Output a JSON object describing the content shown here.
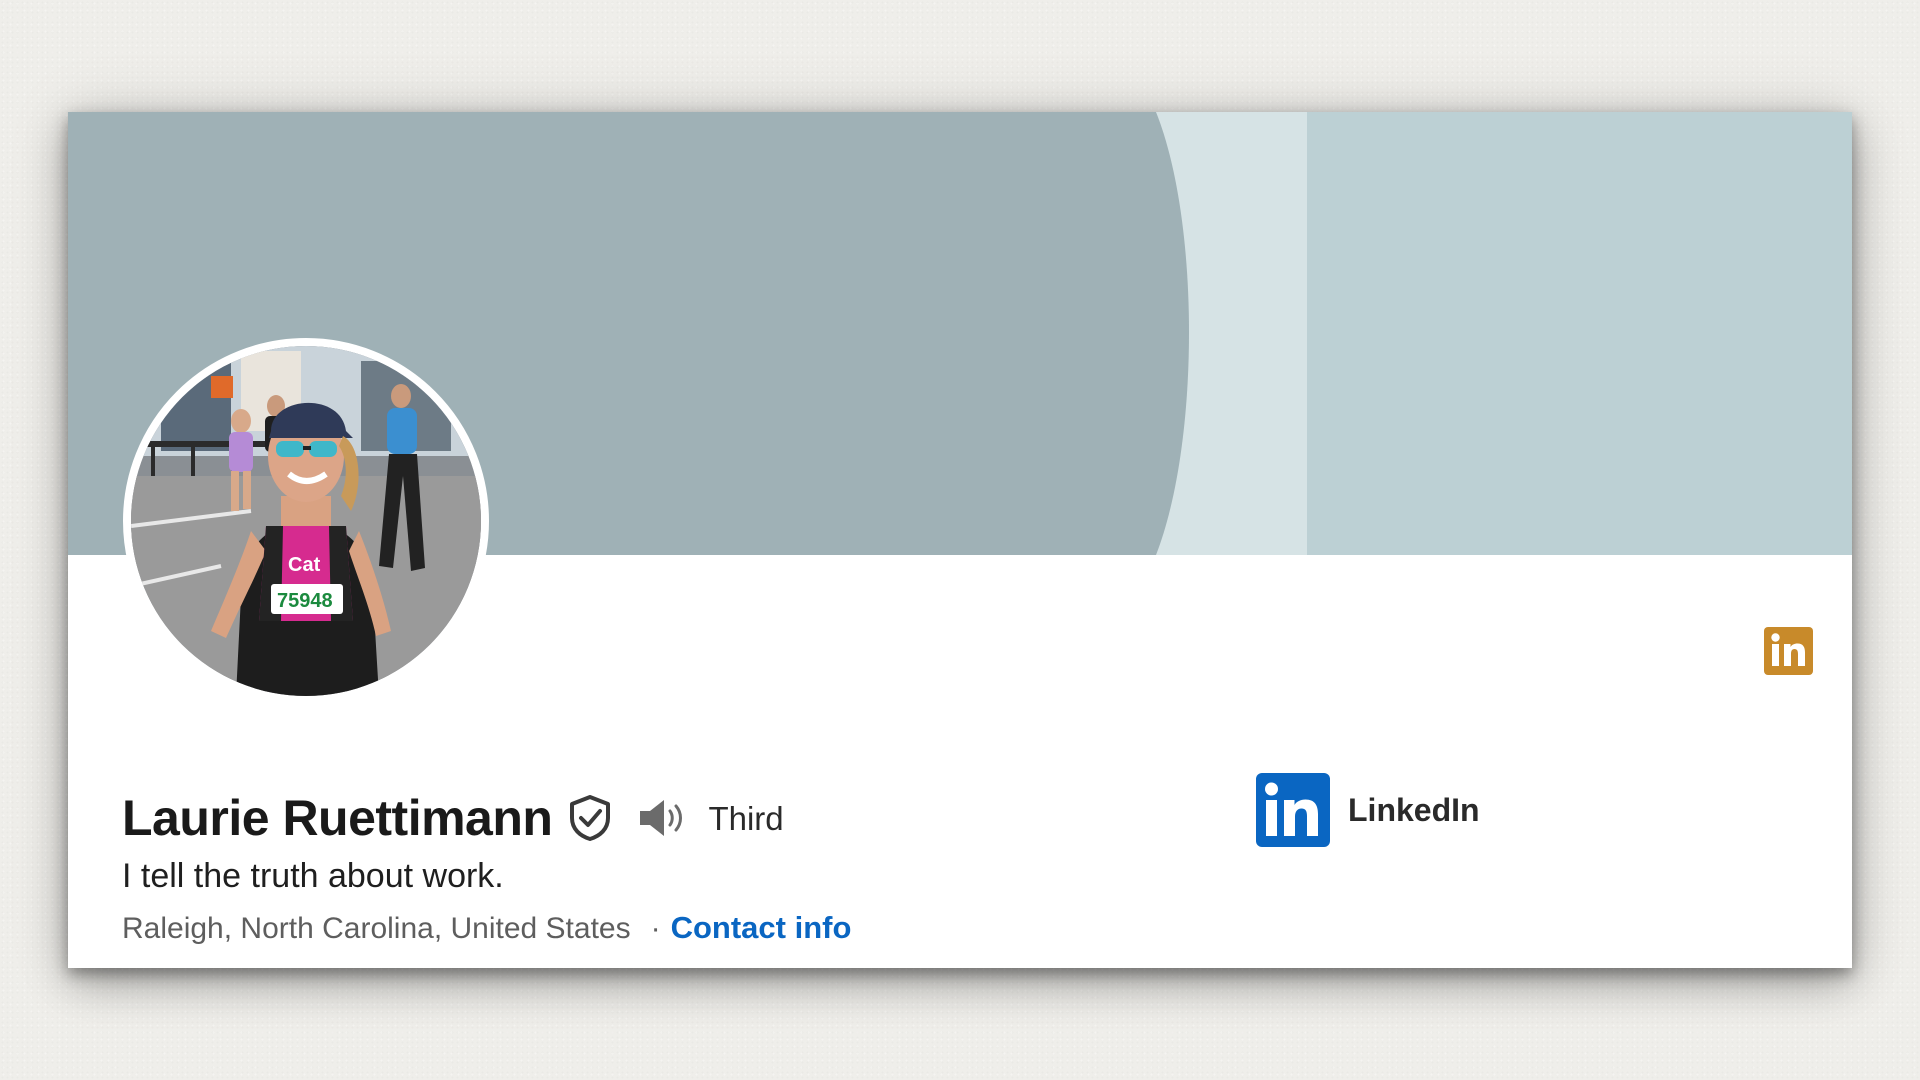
{
  "profile": {
    "name": "Laurie Ruettimann",
    "degree": "Third",
    "headline": "I tell the truth about work.",
    "location": "Raleigh, North Carolina, United States",
    "separator": "·",
    "contact_label": "Contact info",
    "avatar": "runner-photo"
  },
  "company": {
    "name": "LinkedIn",
    "logo_icon": "linkedin-logo"
  },
  "icons": {
    "verified": "shield-check-icon",
    "pronunciation": "speaker-icon",
    "corner_badge": "linkedin-badge-icon"
  },
  "colors": {
    "banner_dark": "#9fb1b6",
    "banner_mid": "#d6e3e5",
    "banner_light": "#bcd0d4",
    "link_blue": "#0a66c2",
    "linkedin_blue": "#0a66c2",
    "badge_gold": "#c88a2a"
  }
}
